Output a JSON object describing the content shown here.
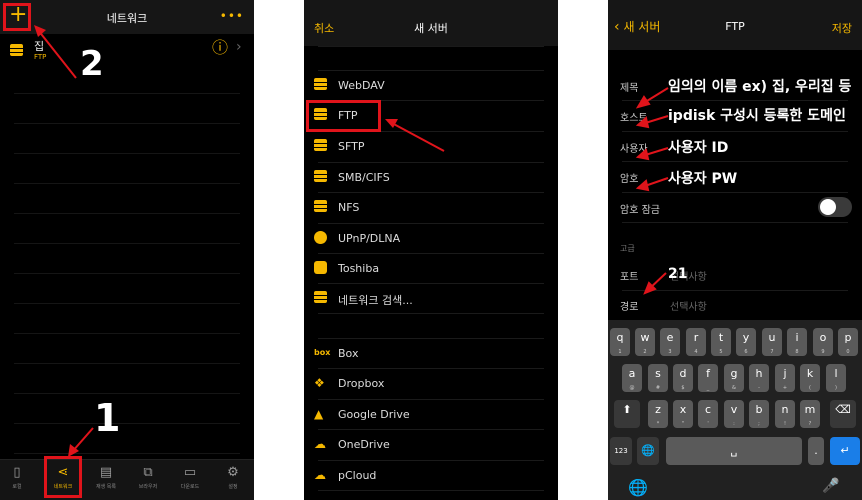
{
  "panel1": {
    "header_title": "네트워크",
    "plus_glyph": "+",
    "more_glyph": "•••",
    "server": {
      "name": "집",
      "type": "FTP",
      "icon": "server-stack-icon"
    },
    "info_glyph": "ⓘ",
    "chevron_glyph": "›",
    "step_label_1": "1",
    "step_label_2": "2",
    "tabs": [
      {
        "label": "로컬",
        "icon": "file-icon"
      },
      {
        "label": "네트워크",
        "icon": "share-icon"
      },
      {
        "label": "재생 목록",
        "icon": "document-icon"
      },
      {
        "label": "브라우저",
        "icon": "browser-icon"
      },
      {
        "label": "다운로드",
        "icon": "download-icon"
      },
      {
        "label": "설정",
        "icon": "gear-icon"
      }
    ],
    "accent_color": "#f5b800",
    "highlight_color": "#e0141b"
  },
  "panel2": {
    "cancel_label": "취소",
    "header_title": "새 서버",
    "protocols": [
      {
        "label": "WebDAV",
        "icon": "server-stack-icon"
      },
      {
        "label": "FTP",
        "icon": "server-stack-icon"
      },
      {
        "label": "SFTP",
        "icon": "server-stack-icon"
      },
      {
        "label": "SMB/CIFS",
        "icon": "server-stack-icon"
      },
      {
        "label": "NFS",
        "icon": "server-stack-icon"
      },
      {
        "label": "UPnP/DLNA",
        "icon": "upnp-icon"
      },
      {
        "label": "Toshiba",
        "icon": "toshiba-icon"
      },
      {
        "label": "네트워크 검색...",
        "icon": "server-stack-icon"
      }
    ],
    "cloud": [
      {
        "label": "Box",
        "icon": "box-icon"
      },
      {
        "label": "Dropbox",
        "icon": "dropbox-icon"
      },
      {
        "label": "Google Drive",
        "icon": "google-drive-icon"
      },
      {
        "label": "OneDrive",
        "icon": "onedrive-icon"
      },
      {
        "label": "pCloud",
        "icon": "pcloud-icon"
      }
    ]
  },
  "panel3": {
    "back_label": "새 서버",
    "header_title": "FTP",
    "save_label": "저장",
    "fields": [
      {
        "label": "제목",
        "note": "임의의 이름 ex) 집, 우리집 등"
      },
      {
        "label": "호스트",
        "note": "ipdisk 구성시 등록한 도메인"
      },
      {
        "label": "사용자",
        "note": "사용자 ID"
      },
      {
        "label": "암호",
        "note": "사용자 PW"
      }
    ],
    "lock_label": "암호 잠금",
    "lock_on": false,
    "section_label": "고급",
    "port_label": "포트",
    "port_placeholder": "선택사항",
    "port_note": "21",
    "path_label": "경로",
    "path_placeholder": "선택사항",
    "keyboard": {
      "row1": [
        [
          "q",
          "1"
        ],
        [
          "w",
          "2"
        ],
        [
          "e",
          "3"
        ],
        [
          "r",
          "4"
        ],
        [
          "t",
          "5"
        ],
        [
          "y",
          "6"
        ],
        [
          "u",
          "7"
        ],
        [
          "i",
          "8"
        ],
        [
          "o",
          "9"
        ],
        [
          "p",
          "0"
        ]
      ],
      "row2": [
        [
          "a",
          "@"
        ],
        [
          "s",
          "#"
        ],
        [
          "d",
          "$"
        ],
        [
          "f",
          "_"
        ],
        [
          "g",
          "&"
        ],
        [
          "h",
          "-"
        ],
        [
          "j",
          "+"
        ],
        [
          "k",
          "("
        ],
        [
          "l",
          ")"
        ]
      ],
      "row3": [
        [
          "z",
          "*"
        ],
        [
          "x",
          "\""
        ],
        [
          "c",
          "'"
        ],
        [
          "v",
          ":"
        ],
        [
          "b",
          ";"
        ],
        [
          "n",
          "!"
        ],
        [
          "m",
          "?"
        ]
      ],
      "num_key": "123",
      "globe_glyph": "🌐",
      "space_glyph": "␣",
      "dot_key": ".",
      "enter_glyph": "↵",
      "shift_glyph": "⬆",
      "delete_glyph": "⌫",
      "mic_glyph": "🎤"
    }
  }
}
